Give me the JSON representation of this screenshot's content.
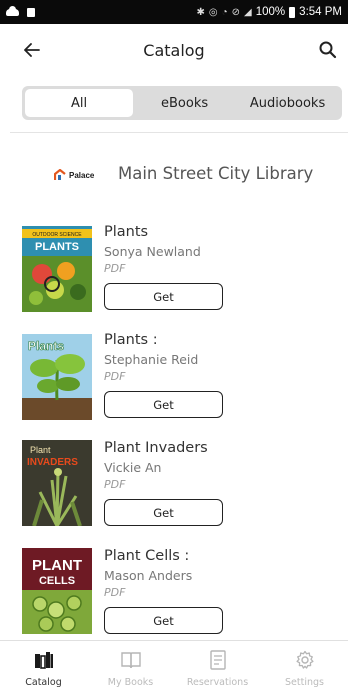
{
  "status_bar": {
    "battery": "100%",
    "time": "3:54 PM"
  },
  "header": {
    "title": "Catalog",
    "back_icon": "arrow-left-icon",
    "search_icon": "search-icon"
  },
  "filter_tabs": [
    {
      "label": "All",
      "selected": true
    },
    {
      "label": "eBooks",
      "selected": false
    },
    {
      "label": "Audiobooks",
      "selected": false
    }
  ],
  "library": {
    "logo_text": "Palace",
    "name": "Main Street City Library"
  },
  "books": [
    {
      "title": "Plants",
      "author": "Sonya Newland",
      "format": "PDF",
      "action": "Get",
      "cover_text": "PLANTS",
      "cover_subtext": "OUTDOOR SCIENCE"
    },
    {
      "title": "Plants :",
      "author": "Stephanie Reid",
      "format": "PDF",
      "action": "Get",
      "cover_text": "Plants",
      "cover_subtext": ""
    },
    {
      "title": "Plant Invaders",
      "author": "Vickie An",
      "format": "PDF",
      "action": "Get",
      "cover_text": "INVADERS",
      "cover_subtext": "Plant"
    },
    {
      "title": "Plant Cells :",
      "author": "Mason Anders",
      "format": "PDF",
      "action": "Get",
      "cover_text": "PLANT",
      "cover_subtext": "CELLS"
    }
  ],
  "tab_bar": [
    {
      "label": "Catalog",
      "icon": "catalog-icon",
      "active": true
    },
    {
      "label": "My Books",
      "icon": "book-icon",
      "active": false
    },
    {
      "label": "Reservations",
      "icon": "reservations-icon",
      "active": false
    },
    {
      "label": "Settings",
      "icon": "gear-icon",
      "active": false
    }
  ]
}
